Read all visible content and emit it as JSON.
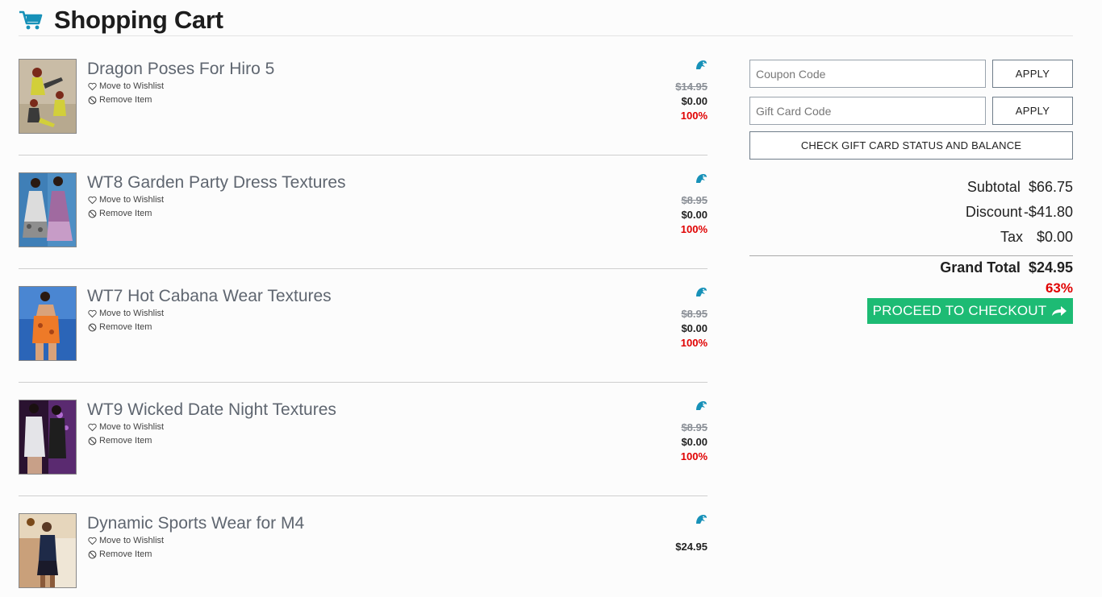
{
  "header": {
    "title": "Shopping Cart",
    "icon": "cart-icon",
    "accent_color": "#1791b8"
  },
  "items": [
    {
      "name": "Dragon Poses For Hiro 5",
      "wishlist_label": "Move to Wishlist",
      "remove_label": "Remove Item",
      "original_price": "$14.95",
      "price": "$0.00",
      "discount": "100%",
      "badge_icon": "platinum-club-badge-icon"
    },
    {
      "name": "WT8 Garden Party Dress Textures",
      "wishlist_label": "Move to Wishlist",
      "remove_label": "Remove Item",
      "original_price": "$8.95",
      "price": "$0.00",
      "discount": "100%",
      "badge_icon": "platinum-club-badge-icon"
    },
    {
      "name": "WT7 Hot Cabana Wear Textures",
      "wishlist_label": "Move to Wishlist",
      "remove_label": "Remove Item",
      "original_price": "$8.95",
      "price": "$0.00",
      "discount": "100%",
      "badge_icon": "platinum-club-badge-icon"
    },
    {
      "name": "WT9 Wicked Date Night Textures",
      "wishlist_label": "Move to Wishlist",
      "remove_label": "Remove Item",
      "original_price": "$8.95",
      "price": "$0.00",
      "discount": "100%",
      "badge_icon": "platinum-club-badge-icon"
    },
    {
      "name": "Dynamic Sports Wear for M4",
      "wishlist_label": "Move to Wishlist",
      "remove_label": "Remove Item",
      "original_price": "",
      "price": "$24.95",
      "discount": "",
      "badge_icon": "platinum-club-badge-icon"
    }
  ],
  "coupon": {
    "placeholder": "Coupon Code",
    "apply_label": "APPLY"
  },
  "gift_card": {
    "placeholder": "Gift Card Code",
    "apply_label": "APPLY",
    "check_label": "CHECK GIFT CARD STATUS AND BALANCE"
  },
  "totals": {
    "subtotal_label": "Subtotal",
    "subtotal": "$66.75",
    "discount_label": "Discount",
    "discount": "-$41.80",
    "tax_label": "Tax",
    "tax": "$0.00",
    "grand_total_label": "Grand Total",
    "grand_total": "$24.95",
    "savings_percent": "63%"
  },
  "checkout": {
    "label": "PROCEED TO CHECKOUT",
    "color": "#1dbb74"
  },
  "colors": {
    "discount_red": "#e00000",
    "strike_gray": "#8a8f96"
  }
}
